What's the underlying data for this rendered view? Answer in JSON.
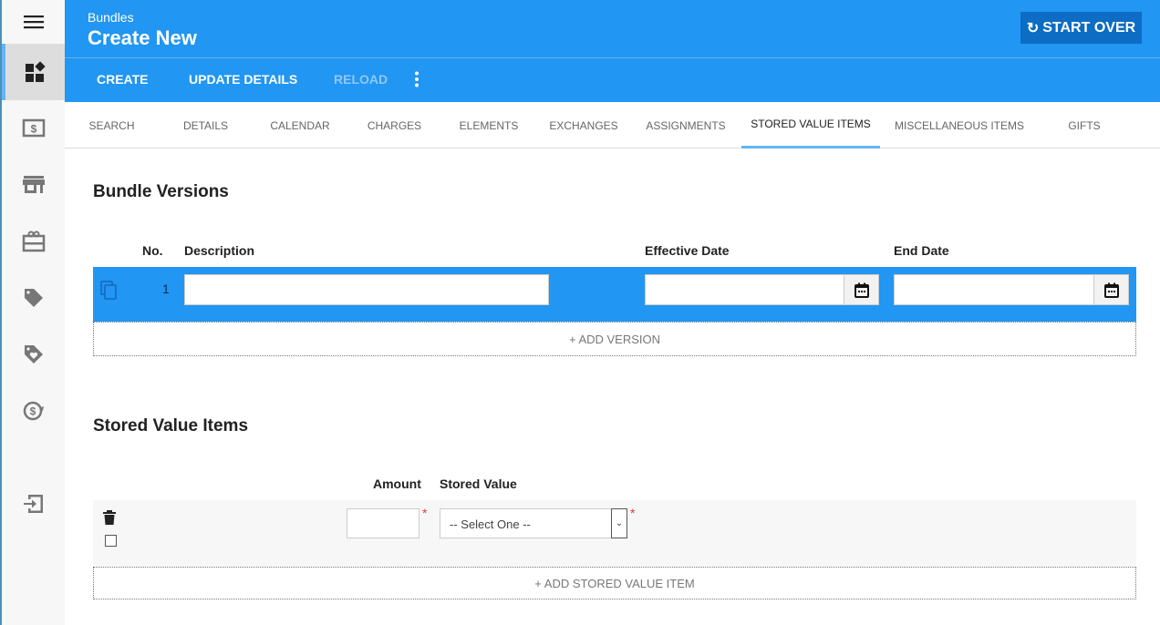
{
  "sidebar": {
    "items": [
      "menu-icon",
      "dashboard-icon",
      "dollar-bill-icon",
      "store-icon",
      "gift-card-icon",
      "tag-icon",
      "tag-heart-icon",
      "currency-exchange-icon",
      "logout-icon"
    ]
  },
  "header": {
    "breadcrumb": "Bundles",
    "title": "Create New",
    "start_over": "START OVER"
  },
  "toolbar": {
    "create": "CREATE",
    "update_details": "UPDATE DETAILS",
    "reload": "RELOAD"
  },
  "tabs": [
    "SEARCH",
    "DETAILS",
    "CALENDAR",
    "CHARGES",
    "ELEMENTS",
    "EXCHANGES",
    "ASSIGNMENTS",
    "STORED VALUE ITEMS",
    "MISCELLANEOUS ITEMS",
    "GIFTS"
  ],
  "active_tab": "STORED VALUE ITEMS",
  "versions": {
    "heading": "Bundle Versions",
    "columns": {
      "no": "No.",
      "description": "Description",
      "effective": "Effective Date",
      "end": "End Date"
    },
    "rows": [
      {
        "no": "1",
        "description": "",
        "effective": "",
        "end": ""
      }
    ],
    "add": "+ ADD VERSION"
  },
  "stored": {
    "heading": "Stored Value Items",
    "columns": {
      "amount": "Amount",
      "stored_value": "Stored Value"
    },
    "rows": [
      {
        "amount": "",
        "stored_value": "-- Select One --"
      }
    ],
    "required": "*",
    "add": "+ ADD STORED VALUE ITEM"
  },
  "colors": {
    "primary": "#2196f3",
    "dark_button": "#0d6cc4",
    "tab_indicator": "#64b5f6"
  }
}
